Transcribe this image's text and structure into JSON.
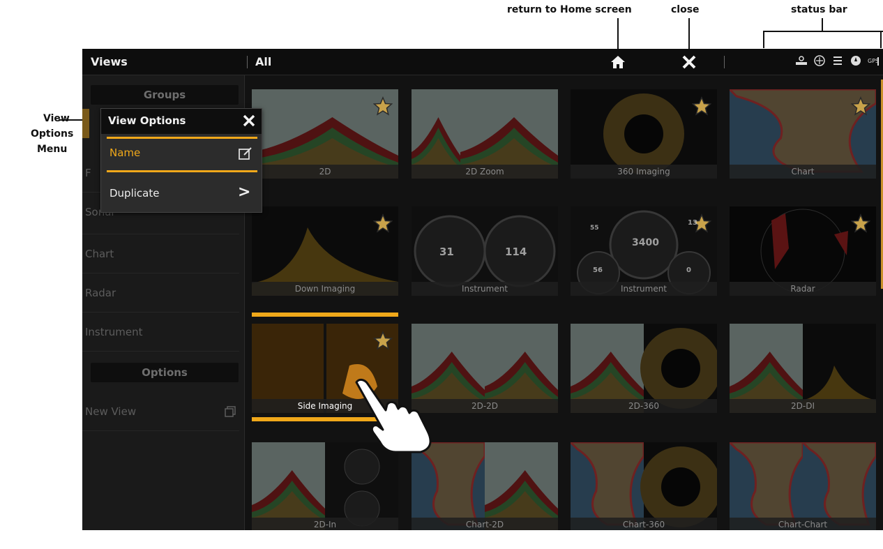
{
  "callouts": {
    "home": "return to Home screen",
    "close": "close",
    "status_bar": "status bar",
    "view_options_menu": [
      "View",
      "Options",
      "Menu"
    ]
  },
  "topbar": {
    "title": "Views",
    "breadcrumb": "All"
  },
  "status_icons": [
    "transducer-icon",
    "chart-icon",
    "sonar-icon",
    "compass-icon",
    "gps-icon"
  ],
  "status_gps_text": "GPS",
  "sidebar": {
    "groups_header": "Groups",
    "items": [
      {
        "label": "F"
      },
      {
        "label": "Sonar"
      },
      {
        "label": "Chart"
      },
      {
        "label": "Radar"
      },
      {
        "label": "Instrument"
      }
    ],
    "options_header": "Options",
    "new_view": "New View"
  },
  "view_options": {
    "title": "View Options",
    "name_label": "Name",
    "duplicate_label": "Duplicate",
    "duplicate_arrow": ">"
  },
  "tiles": [
    {
      "label": "2D",
      "favorite": true
    },
    {
      "label": "2D Zoom",
      "favorite": false
    },
    {
      "label": "360 Imaging",
      "favorite": true
    },
    {
      "label": "Chart",
      "favorite": true
    },
    {
      "label": "Down Imaging",
      "favorite": true
    },
    {
      "label": "Instrument",
      "favorite": false
    },
    {
      "label": "Instrument",
      "favorite": true
    },
    {
      "label": "Radar",
      "favorite": true
    },
    {
      "label": "Side Imaging",
      "favorite": true,
      "selected": true
    },
    {
      "label": "2D-2D",
      "favorite": false
    },
    {
      "label": "2D-360",
      "favorite": false
    },
    {
      "label": "2D-DI",
      "favorite": false
    },
    {
      "label": "2D-In",
      "favorite": false
    },
    {
      "label": "Chart-2D",
      "favorite": false
    },
    {
      "label": "Chart-360",
      "favorite": false
    },
    {
      "label": "Chart-Chart",
      "favorite": false
    }
  ],
  "gauge_readouts": {
    "instrument_a_left": "31",
    "instrument_a_right": "114",
    "instrument_b_center": "3400",
    "instrument_b_left": "56",
    "instrument_b_right": "0",
    "instrument_b_top_left": "55",
    "instrument_b_top_right": "13"
  },
  "colors": {
    "accent": "#f0a81a",
    "background": "#121212",
    "sidebar": "#1a1a1a"
  }
}
